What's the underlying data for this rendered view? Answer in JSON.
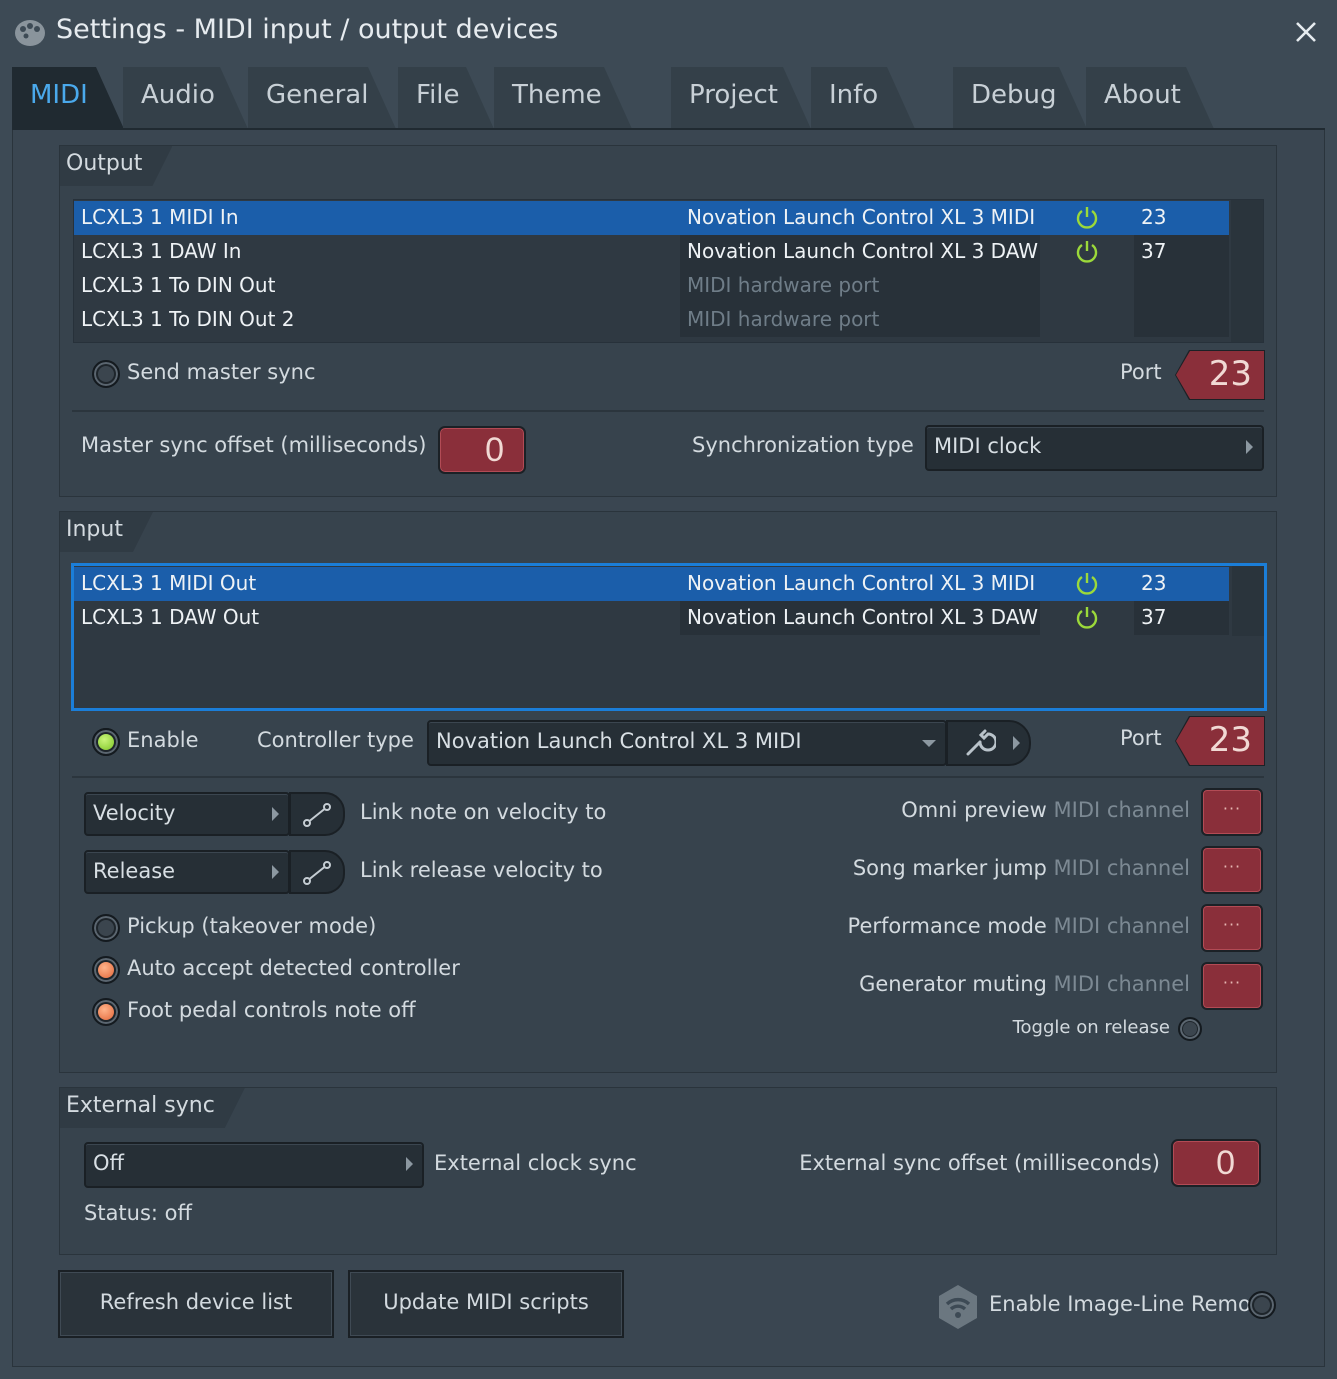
{
  "window": {
    "title": "Settings - MIDI input / output devices"
  },
  "tabs": [
    "MIDI",
    "Audio",
    "General",
    "File",
    "Theme",
    "Project",
    "Info",
    "Debug",
    "About"
  ],
  "output": {
    "section_title": "Output",
    "devices": [
      {
        "name": "LCXL3 1 MIDI In",
        "device": "Novation Launch Control XL 3 MIDI",
        "enabled": true,
        "port": "23"
      },
      {
        "name": "LCXL3 1 DAW In",
        "device": "Novation Launch Control XL 3 DAW",
        "enabled": true,
        "port": "37"
      },
      {
        "name": "LCXL3 1 To DIN Out",
        "device": "MIDI hardware port",
        "enabled": false,
        "port": ""
      },
      {
        "name": "LCXL3 1 To DIN Out 2",
        "device": "MIDI hardware port",
        "enabled": false,
        "port": ""
      }
    ],
    "send_master_sync_label": "Send master sync",
    "port_label": "Port",
    "port_value": "23",
    "master_sync_offset_label": "Master sync offset (milliseconds)",
    "master_sync_offset_value": "0",
    "sync_type_label": "Synchronization type",
    "sync_type_value": "MIDI clock"
  },
  "input": {
    "section_title": "Input",
    "devices": [
      {
        "name": "LCXL3 1 MIDI Out",
        "device": "Novation Launch Control XL 3 MIDI",
        "enabled": true,
        "port": "23"
      },
      {
        "name": "LCXL3 1 DAW Out",
        "device": "Novation Launch Control XL 3 DAW",
        "enabled": true,
        "port": "37"
      }
    ],
    "enable_label": "Enable",
    "controller_type_label": "Controller type",
    "controller_type_value": "Novation Launch Control XL 3 MIDI",
    "port_label": "Port",
    "port_value": "23",
    "velocity_value": "Velocity",
    "link_note_on_label": "Link note on velocity to",
    "release_value": "Release",
    "link_release_label": "Link release velocity to",
    "pickup_label": "Pickup (takeover mode)",
    "auto_accept_label": "Auto accept detected controller",
    "foot_pedal_label": "Foot pedal controls note off",
    "channel_suffix": "MIDI channel",
    "channel_rows": [
      {
        "label": "Omni preview",
        "value": "···"
      },
      {
        "label": "Song marker jump",
        "value": "···"
      },
      {
        "label": "Performance mode",
        "value": "···"
      },
      {
        "label": "Generator muting",
        "value": "···"
      }
    ],
    "toggle_on_release_label": "Toggle on release"
  },
  "external_sync": {
    "section_title": "External sync",
    "clock_value": "Off",
    "clock_label": "External clock sync",
    "offset_label": "External sync offset (milliseconds)",
    "offset_value": "0",
    "status": "Status: off"
  },
  "footer": {
    "refresh_label": "Refresh device list",
    "update_label": "Update MIDI scripts",
    "remote_label": "Enable Image-Line Remote"
  },
  "colors": {
    "background": "#3d4a55",
    "selection": "#1b5eaa",
    "accent_tab": "#4aa9ec",
    "red_field": "#8a2f3a",
    "power_on": "#9bd93a"
  }
}
